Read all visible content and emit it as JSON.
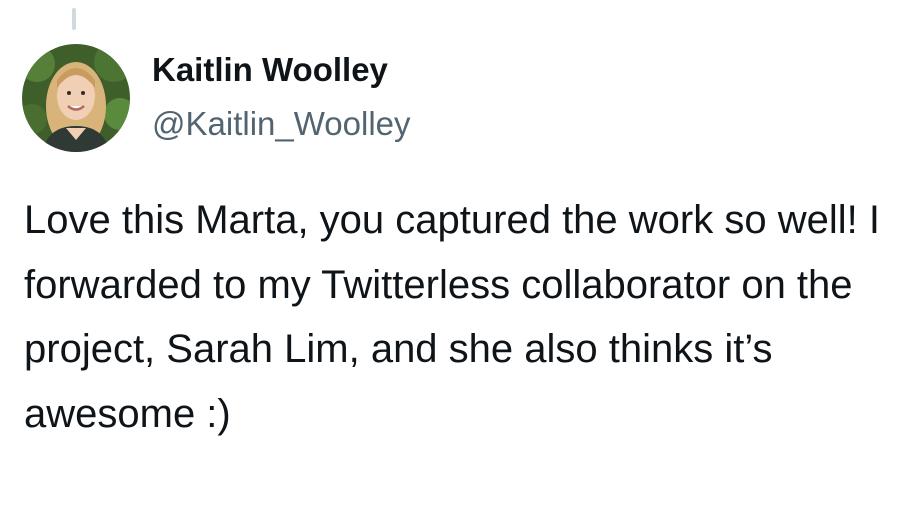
{
  "tweet": {
    "author_name": "Kaitlin Woolley",
    "author_handle": "@Kaitlin_Woolley",
    "text": "Love this Marta, you captured the work so well! I forwarded to my Twitterless collaborator on the project, Sarah Lim, and she also thinks it’s awesome :)"
  },
  "colors": {
    "text": "#0f1419",
    "secondary_text": "#536471",
    "thread_line": "#cfd9de",
    "background": "#ffffff"
  }
}
